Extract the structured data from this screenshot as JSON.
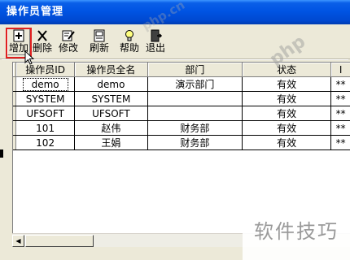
{
  "window": {
    "title": "操作员管理"
  },
  "toolbar": {
    "buttons": [
      {
        "id": "add",
        "label": "增加",
        "icon": "add-document-icon"
      },
      {
        "id": "delete",
        "label": "删除",
        "icon": "delete-x-icon"
      },
      {
        "id": "modify",
        "label": "修改",
        "icon": "edit-icon"
      },
      {
        "id": "refresh",
        "label": "刷新",
        "icon": "refresh-icon"
      },
      {
        "id": "help",
        "label": "帮助",
        "icon": "help-bulb-icon"
      },
      {
        "id": "exit",
        "label": "退出",
        "icon": "exit-door-icon"
      }
    ]
  },
  "grid": {
    "columns": [
      "操作员ID",
      "操作员全名",
      "部门",
      "状态",
      "I"
    ],
    "rows": [
      [
        "demo",
        "demo",
        "演示部门",
        "有效",
        "**"
      ],
      [
        "SYSTEM",
        "SYSTEM",
        "",
        "有效",
        "**"
      ],
      [
        "UFSOFT",
        "UFSOFT",
        "",
        "有效",
        "**"
      ],
      [
        "101",
        "赵伟",
        "财务部",
        "有效",
        "**"
      ],
      [
        "102",
        "王娟",
        "财务部",
        "有效",
        "**"
      ]
    ]
  },
  "scrollbar": {
    "left_arrow": "◀",
    "right_arrow": "▶"
  },
  "watermarks": {
    "faint": "php.cn",
    "large": "php"
  },
  "brand": {
    "text": "软件技巧"
  },
  "colors": {
    "title_bar": "#0054e3",
    "highlight": "#e02020",
    "chrome": "#ece9d8"
  }
}
